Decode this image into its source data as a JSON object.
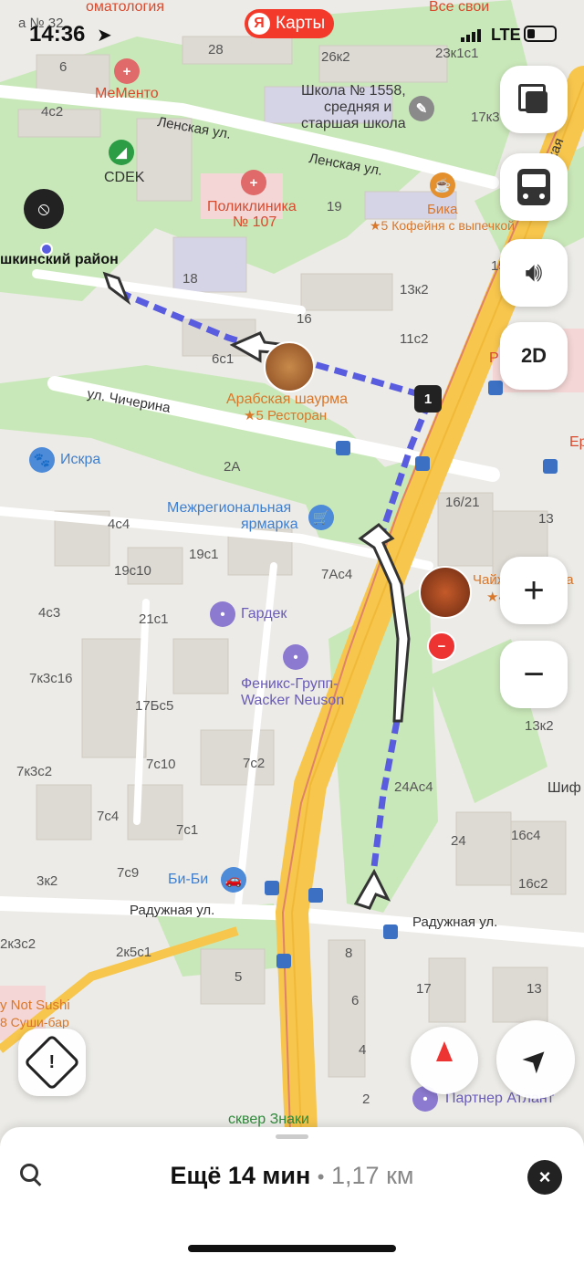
{
  "status_bar": {
    "time": "14:36",
    "network": "LTE"
  },
  "app_badge": {
    "label": "Карты",
    "logo_letter": "Я",
    "color": "#f33a2a"
  },
  "map": {
    "streets": [
      "Ленская ул.",
      "Ленская ул.",
      "ул. Чичерина",
      "Радужная ул.",
      "Радужная ул."
    ],
    "street_partial": [
      "Енисейская"
    ],
    "pois": {
      "memento": "МеМенто",
      "cdek": "CDEK",
      "school": [
        "Школа № 1558,",
        "средняя и",
        "старшая школа"
      ],
      "polyclinic": [
        "Поликлиника",
        "№ 107"
      ],
      "bika": "Бика",
      "bika_sub": "★5 Кофейня с выпечкой",
      "shawarma": "Арабская шаурма",
      "shawarma_sub": "★5 Ресторан",
      "iskra": "Искра",
      "fair": [
        "Межрегиональная",
        "ярмарка"
      ],
      "gardek": "Гардек",
      "phoenix": [
        "Феникс-Групп-",
        "Wacker Neuson"
      ],
      "bibi": "Би-Би",
      "chaikhana": "Чайхана Якката",
      "chaikhana_sub": "★4.3",
      "sushi": "y Not Sushi",
      "sushi_sub": "8 Суши-бар",
      "partner": "Партнер Атлант",
      "square": "сквер Знаки",
      "stomatology": "оматология",
      "stomatology_num": "а № 32",
      "vse_svoi": "Все свои",
      "district": "шкинский район",
      "shif": "Шиф",
      "er": "Ер",
      "r": "Р"
    },
    "buildings": [
      "6",
      "28",
      "26к2",
      "23к1с1",
      "4с2",
      "17к3",
      "19",
      "18",
      "13к2",
      "15",
      "16",
      "6с1",
      "11с2",
      "2А",
      "16/21",
      "13",
      "4с4",
      "19с1",
      "19с10",
      "7Ас4",
      "4с3",
      "21с1",
      "7к3с16",
      "17Бс5",
      "13к2",
      "7с10",
      "7с2",
      "7к3с2",
      "24Ас4",
      "7с4",
      "24",
      "16с4",
      "7с1",
      "7с9",
      "3к2",
      "16с2",
      "2к3с2",
      "2к5с1",
      "8",
      "5",
      "17",
      "13",
      "6",
      "4",
      "2"
    ],
    "maneuver_number": "1",
    "layers_button": "layers",
    "transport_button": "bus",
    "sound_button": "sound",
    "view_mode": "2D",
    "zoom_in": "+",
    "zoom_out": "−"
  },
  "route_color": "#5a5ce0",
  "bottom_bar": {
    "remaining_time": "Ещё 14 мин",
    "separator": "•",
    "distance": "1,17 км"
  }
}
